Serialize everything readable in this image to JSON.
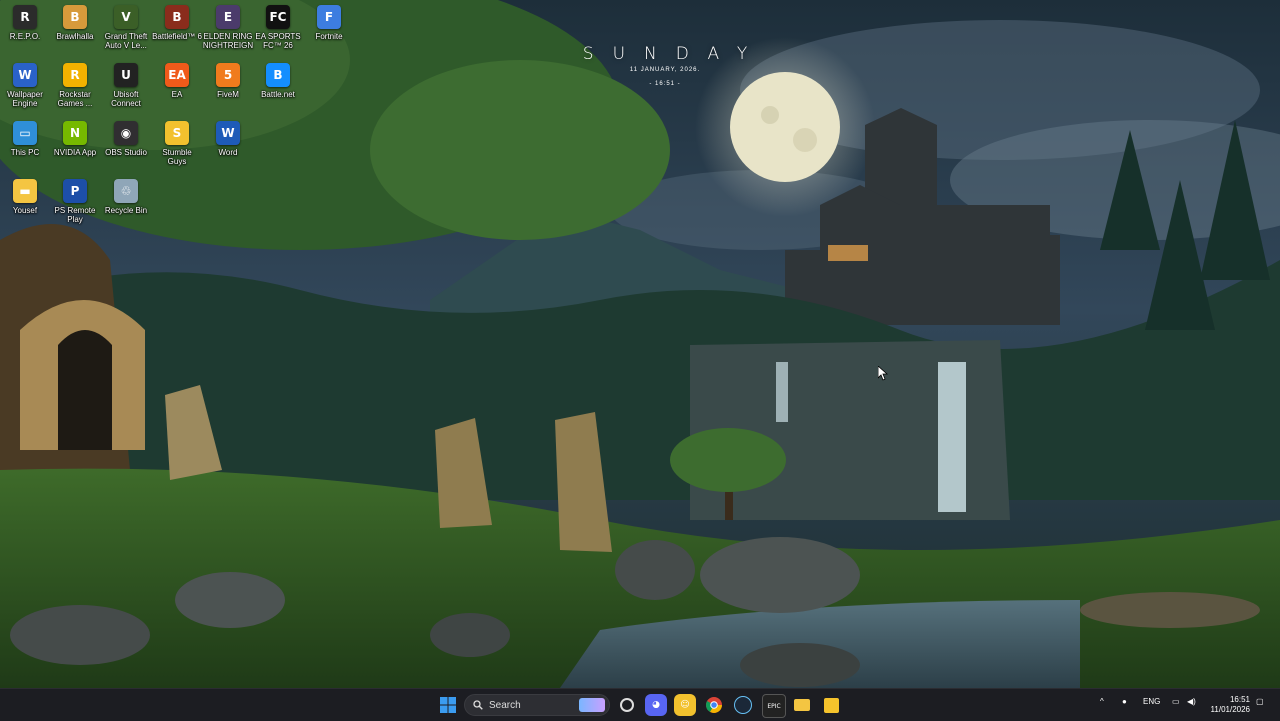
{
  "desktop": {
    "icons": [
      {
        "label": "R.E.P.O.",
        "glyph": "R",
        "color": "#2b2b2b",
        "icon": "repo-game-icon"
      },
      {
        "label": "Brawlhalla",
        "glyph": "B",
        "color": "#d79a3b",
        "icon": "brawlhalla-icon"
      },
      {
        "label": "Grand Theft\nAuto V Le...",
        "glyph": "V",
        "color": "#3b5f27",
        "icon": "gta-v-icon"
      },
      {
        "label": "Battlefield™ 6",
        "glyph": "B",
        "color": "#8a2c1c",
        "icon": "battlefield-icon"
      },
      {
        "label": "ELDEN RING\nNIGHTREIGN",
        "glyph": "E",
        "color": "#4b3b6b",
        "icon": "elden-ring-icon"
      },
      {
        "label": "EA SPORTS\nFC™ 26",
        "glyph": "FC",
        "color": "#111111",
        "icon": "ea-fc-icon"
      },
      {
        "label": "Fortnite",
        "glyph": "F",
        "color": "#3d7de0",
        "icon": "fortnite-icon"
      },
      {
        "label": "Wallpaper\nEngine",
        "glyph": "W",
        "color": "#2a62c9",
        "icon": "wallpaper-engine-icon"
      },
      {
        "label": "Rockstar\nGames ...",
        "glyph": "R",
        "color": "#f2b200",
        "icon": "rockstar-icon"
      },
      {
        "label": "Ubisoft\nConnect",
        "glyph": "U",
        "color": "#222222",
        "icon": "ubisoft-icon"
      },
      {
        "label": "EA",
        "glyph": "EA",
        "color": "#f05a1a",
        "icon": "ea-app-icon"
      },
      {
        "label": "FiveM",
        "glyph": "5",
        "color": "#f07b1d",
        "icon": "fivem-icon"
      },
      {
        "label": "Battle.net",
        "glyph": "B",
        "color": "#148eff",
        "icon": "battle-net-icon"
      },
      {
        "label": "This PC",
        "glyph": "▭",
        "color": "#2f8fd8",
        "icon": "this-pc-icon"
      },
      {
        "label": "NVIDIA App",
        "glyph": "N",
        "color": "#76b900",
        "icon": "nvidia-icon"
      },
      {
        "label": "OBS Studio",
        "glyph": "◉",
        "color": "#302e31",
        "icon": "obs-icon"
      },
      {
        "label": "Stumble\nGuys",
        "glyph": "S",
        "color": "#f2c12e",
        "icon": "stumble-guys-icon"
      },
      {
        "label": "Word",
        "glyph": "W",
        "color": "#1e5bb8",
        "icon": "word-icon"
      },
      {
        "label": "Yousef",
        "glyph": "▬",
        "color": "#f4c542",
        "icon": "folder-icon"
      },
      {
        "label": "PS Remote\nPlay",
        "glyph": "P",
        "color": "#1d4fa8",
        "icon": "ps-remote-play-icon"
      },
      {
        "label": "Recycle Bin",
        "glyph": "♲",
        "color": "#8fa6b8",
        "icon": "recycle-bin-icon"
      }
    ]
  },
  "widget": {
    "day": "SUNDAY",
    "date": "11 JANUARY, 2026.",
    "time": "- 16:51 -"
  },
  "taskbar": {
    "search_placeholder": "Search",
    "language": "ENG",
    "time": "16:51",
    "date": "11/01/2026"
  },
  "colors": {
    "taskbar_bg": "#1c1d22",
    "start_blue": "#3b9cf0"
  }
}
